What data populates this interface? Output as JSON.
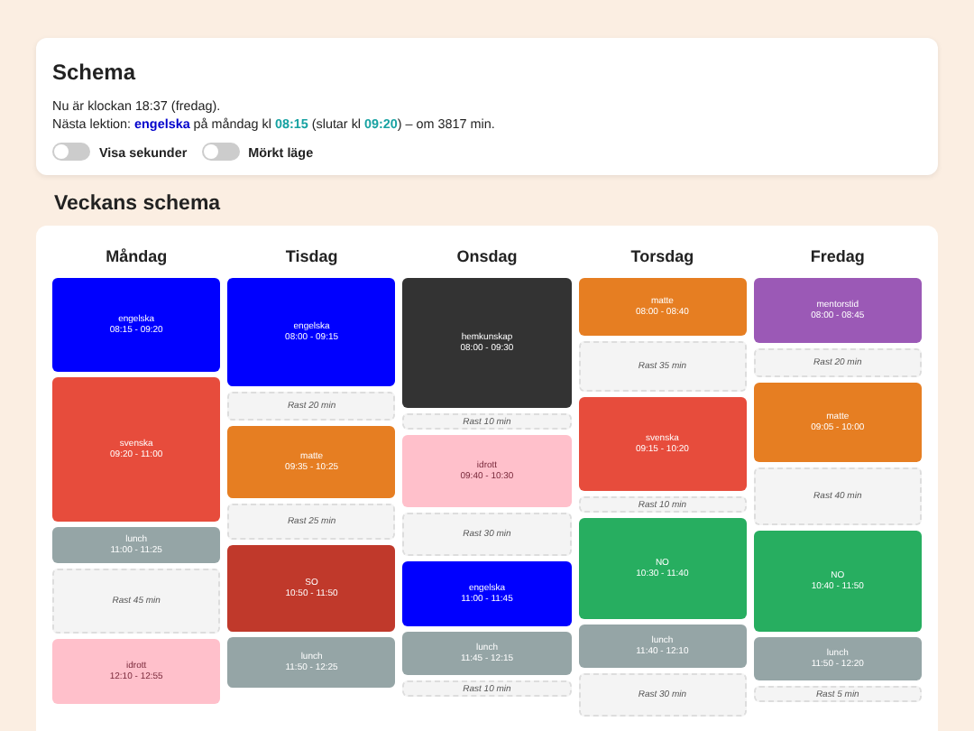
{
  "header": {
    "title": "Schema",
    "now": "Nu är klockan 18:37 (fredag).",
    "next_lesson": [
      {
        "kind": "plain",
        "text": "Nästa lektion: "
      },
      {
        "kind": "subject",
        "text": "engelska"
      },
      {
        "kind": "plain",
        "text": " på måndag kl "
      },
      {
        "kind": "time",
        "text": "08:15"
      },
      {
        "kind": "plain",
        "text": " (slutar kl "
      },
      {
        "kind": "time",
        "text": "09:20"
      },
      {
        "kind": "plain",
        "text": ") – om 3817 min."
      }
    ],
    "toggles": [
      {
        "label": "Visa sekunder",
        "on": false
      },
      {
        "label": "Mörkt läge",
        "on": false
      }
    ]
  },
  "week": {
    "title": "Veckans schema",
    "days": [
      {
        "name": "Måndag",
        "blocks": [
          {
            "kind": "lesson",
            "subject": "engelska",
            "time": "08:15 - 09:20",
            "color": "#0000ff"
          },
          {
            "kind": "lesson",
            "subject": "svenska",
            "time": "09:20 - 11:00",
            "color": "#e74c3c"
          },
          {
            "kind": "lesson",
            "subject": "lunch",
            "time": "11:00 - 11:25",
            "color": "#95a5a6"
          },
          {
            "kind": "break",
            "text": "Rast 45 min"
          },
          {
            "kind": "lesson",
            "subject": "idrott",
            "time": "12:10 - 12:55",
            "color": "#ffc0cb"
          }
        ]
      },
      {
        "name": "Tisdag",
        "blocks": [
          {
            "kind": "lesson",
            "subject": "engelska",
            "time": "08:00 - 09:15",
            "color": "#0000ff"
          },
          {
            "kind": "break",
            "text": "Rast 20 min"
          },
          {
            "kind": "lesson",
            "subject": "matte",
            "time": "09:35 - 10:25",
            "color": "#e67e22"
          },
          {
            "kind": "break",
            "text": "Rast 25 min"
          },
          {
            "kind": "lesson",
            "subject": "SO",
            "time": "10:50 - 11:50",
            "color": "#c0392b"
          },
          {
            "kind": "lesson",
            "subject": "lunch",
            "time": "11:50 - 12:25",
            "color": "#95a5a6"
          }
        ]
      },
      {
        "name": "Onsdag",
        "blocks": [
          {
            "kind": "lesson",
            "subject": "hemkunskap",
            "time": "08:00 - 09:30",
            "color": "#333333"
          },
          {
            "kind": "break",
            "text": "Rast 10 min"
          },
          {
            "kind": "lesson",
            "subject": "idrott",
            "time": "09:40 - 10:30",
            "color": "#ffc0cb"
          },
          {
            "kind": "break",
            "text": "Rast 30 min"
          },
          {
            "kind": "lesson",
            "subject": "engelska",
            "time": "11:00 - 11:45",
            "color": "#0000ff"
          },
          {
            "kind": "lesson",
            "subject": "lunch",
            "time": "11:45 - 12:15",
            "color": "#95a5a6"
          },
          {
            "kind": "break",
            "text": "Rast 10 min"
          }
        ]
      },
      {
        "name": "Torsdag",
        "blocks": [
          {
            "kind": "lesson",
            "subject": "matte",
            "time": "08:00 - 08:40",
            "color": "#e67e22"
          },
          {
            "kind": "break",
            "text": "Rast 35 min"
          },
          {
            "kind": "lesson",
            "subject": "svenska",
            "time": "09:15 - 10:20",
            "color": "#e74c3c"
          },
          {
            "kind": "break",
            "text": "Rast 10 min"
          },
          {
            "kind": "lesson",
            "subject": "NO",
            "time": "10:30 - 11:40",
            "color": "#27ae60"
          },
          {
            "kind": "lesson",
            "subject": "lunch",
            "time": "11:40 - 12:10",
            "color": "#95a5a6"
          },
          {
            "kind": "break",
            "text": "Rast 30 min"
          }
        ]
      },
      {
        "name": "Fredag",
        "blocks": [
          {
            "kind": "lesson",
            "subject": "mentorstid",
            "time": "08:00 - 08:45",
            "color": "#9b59b6"
          },
          {
            "kind": "break",
            "text": "Rast 20 min"
          },
          {
            "kind": "lesson",
            "subject": "matte",
            "time": "09:05 - 10:00",
            "color": "#e67e22"
          },
          {
            "kind": "break",
            "text": "Rast 40 min"
          },
          {
            "kind": "lesson",
            "subject": "NO",
            "time": "10:40 - 11:50",
            "color": "#27ae60"
          },
          {
            "kind": "lesson",
            "subject": "lunch",
            "time": "11:50 - 12:20",
            "color": "#95a5a6"
          },
          {
            "kind": "break",
            "text": "Rast 5 min"
          }
        ]
      }
    ]
  }
}
